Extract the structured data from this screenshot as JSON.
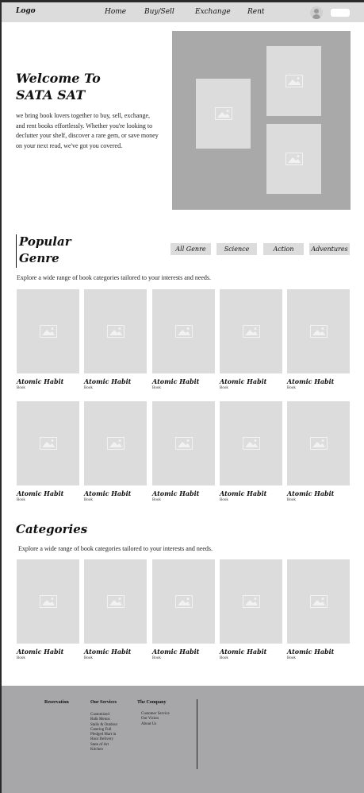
{
  "nav": {
    "logo": "Logo",
    "links": [
      "Home",
      "Buy/Sell",
      "Exchange",
      "Rent"
    ]
  },
  "hero": {
    "title_line1": "Welcome To",
    "title_line2": "SATA SAT",
    "description": "we bring book lovers together to buy, sell, exchange, and rent books effortlessly. Whether you're looking to declutter your shelf, discover a rare gem, or save money on your next read, we've got you covered."
  },
  "popular": {
    "title_line1": "Popular",
    "title_line2": "Genre",
    "genres": [
      "All Genre",
      "Science",
      "Action",
      "Adventures"
    ],
    "description": "Explore a wide range of book categories tailored to your interests and needs.",
    "books": [
      {
        "title": "Atomic Habit",
        "subtitle": "Book"
      },
      {
        "title": "Atomic Habit",
        "subtitle": "Book"
      },
      {
        "title": "Atomic Habit",
        "subtitle": "Book"
      },
      {
        "title": "Atomic Habit",
        "subtitle": "Book"
      },
      {
        "title": "Atomic Habit",
        "subtitle": "Book"
      },
      {
        "title": "Atomic Habit",
        "subtitle": "Book"
      },
      {
        "title": "Atomic Habit",
        "subtitle": "Book"
      },
      {
        "title": "Atomic Habit",
        "subtitle": "Book"
      },
      {
        "title": "Atomic Habit",
        "subtitle": "Book"
      },
      {
        "title": "Atomic Habit",
        "subtitle": "Book"
      }
    ]
  },
  "categories": {
    "title": "Categories",
    "description": "Explore a wide range of book categories tailored to your interests and needs.",
    "books": [
      {
        "title": "Atomic Habit",
        "subtitle": "Book"
      },
      {
        "title": "Atomic Habit",
        "subtitle": "Book"
      },
      {
        "title": "Atomic Habit",
        "subtitle": "Book"
      },
      {
        "title": "Atomic Habit",
        "subtitle": "Book"
      },
      {
        "title": "Atomic Habit",
        "subtitle": "Book"
      }
    ]
  },
  "footer": {
    "col1_title": "Reservation",
    "col2_title": "Our Services",
    "col2_items": [
      "Customized",
      "Bulk Menus",
      "Stalls & Outdoor",
      "Catering Full",
      "Pledged Mart in",
      "Hour Delivery",
      "State of Art",
      "Kitchen"
    ],
    "col3_title": "The Company",
    "col3_items": [
      "Customer Service",
      "Our Vision",
      "About Us"
    ]
  },
  "icons": {
    "avatar": "user-avatar-icon",
    "placeholder": "image-placeholder-icon"
  },
  "colors": {
    "nav_bg": "#dcdcdc",
    "placeholder": "#dcdcdc",
    "hero_box": "#a9a9a9",
    "footer_bg": "#a7a7a9"
  }
}
